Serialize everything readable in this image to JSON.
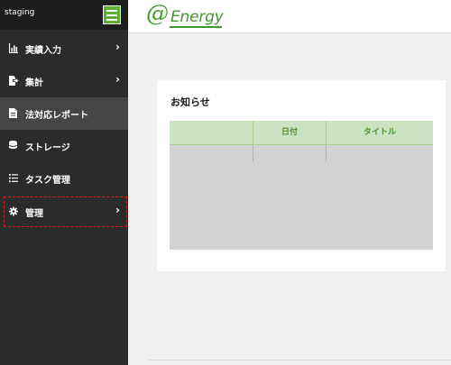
{
  "sidebar": {
    "env_label": "staging",
    "items": [
      {
        "label": "実績入力",
        "icon": "bar-chart-icon",
        "has_chevron": true
      },
      {
        "label": "集計",
        "icon": "file-export-icon",
        "has_chevron": true
      },
      {
        "label": "法対応レポート",
        "icon": "document-icon",
        "has_chevron": false
      },
      {
        "label": "ストレージ",
        "icon": "database-icon",
        "has_chevron": false
      },
      {
        "label": "タスク管理",
        "icon": "task-list-icon",
        "has_chevron": false
      },
      {
        "label": "管理",
        "icon": "gear-icon",
        "has_chevron": true
      }
    ],
    "chevron": "›"
  },
  "header": {
    "logo_at": "@",
    "logo_word": "Energy"
  },
  "notice": {
    "title": "お知らせ",
    "columns": [
      "",
      "日付",
      "タイトル"
    ]
  },
  "colors": {
    "sidebar_bg": "#2a2b2b",
    "accent_green": "#5fb035",
    "table_header_bg": "#cbe3c0",
    "focus_outline": "#d81b1b"
  }
}
